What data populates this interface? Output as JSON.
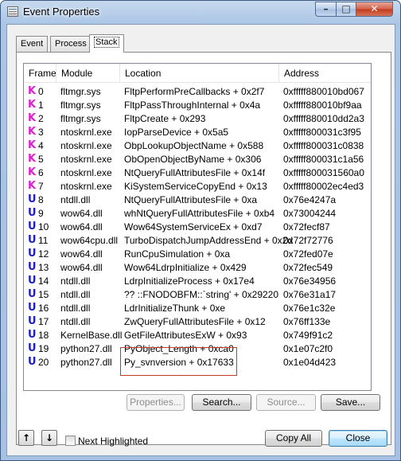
{
  "window": {
    "title": "Event Properties"
  },
  "caption_buttons": {
    "minimize": "–",
    "maximize": "□",
    "close": "✕"
  },
  "tabs": [
    {
      "label": "Event"
    },
    {
      "label": "Process"
    },
    {
      "label": "Stack"
    }
  ],
  "table": {
    "headers": {
      "frame": "Frame",
      "module": "Module",
      "location": "Location",
      "address": "Address"
    },
    "rows": [
      {
        "kind": "K",
        "frame": "0",
        "module": "fltmgr.sys",
        "location": "FltpPerformPreCallbacks + 0x2f7",
        "address": "0xfffff880010bd067"
      },
      {
        "kind": "K",
        "frame": "1",
        "module": "fltmgr.sys",
        "location": "FltpPassThroughInternal + 0x4a",
        "address": "0xfffff880010bf9aa"
      },
      {
        "kind": "K",
        "frame": "2",
        "module": "fltmgr.sys",
        "location": "FltpCreate + 0x293",
        "address": "0xfffff880010dd2a3"
      },
      {
        "kind": "K",
        "frame": "3",
        "module": "ntoskrnl.exe",
        "location": "IopParseDevice + 0x5a5",
        "address": "0xfffff800031c3f95"
      },
      {
        "kind": "K",
        "frame": "4",
        "module": "ntoskrnl.exe",
        "location": "ObpLookupObjectName + 0x588",
        "address": "0xfffff800031c0838"
      },
      {
        "kind": "K",
        "frame": "5",
        "module": "ntoskrnl.exe",
        "location": "ObOpenObjectByName + 0x306",
        "address": "0xfffff800031c1a56"
      },
      {
        "kind": "K",
        "frame": "6",
        "module": "ntoskrnl.exe",
        "location": "NtQueryFullAttributesFile + 0x14f",
        "address": "0xfffff800031560a0"
      },
      {
        "kind": "K",
        "frame": "7",
        "module": "ntoskrnl.exe",
        "location": "KiSystemServiceCopyEnd + 0x13",
        "address": "0xfffff80002ec4ed3"
      },
      {
        "kind": "U",
        "frame": "8",
        "module": "ntdll.dll",
        "location": "NtQueryFullAttributesFile + 0xa",
        "address": "0x76e4247a"
      },
      {
        "kind": "U",
        "frame": "9",
        "module": "wow64.dll",
        "location": "whNtQueryFullAttributesFile + 0xb4",
        "address": "0x73004244"
      },
      {
        "kind": "U",
        "frame": "10",
        "module": "wow64.dll",
        "location": "Wow64SystemServiceEx + 0xd7",
        "address": "0x72fecf87"
      },
      {
        "kind": "U",
        "frame": "11",
        "module": "wow64cpu.dll",
        "location": "TurboDispatchJumpAddressEnd + 0x2d",
        "address": "0x72f72776"
      },
      {
        "kind": "U",
        "frame": "12",
        "module": "wow64.dll",
        "location": "RunCpuSimulation + 0xa",
        "address": "0x72fed07e"
      },
      {
        "kind": "U",
        "frame": "13",
        "module": "wow64.dll",
        "location": "Wow64LdrpInitialize + 0x429",
        "address": "0x72fec549"
      },
      {
        "kind": "U",
        "frame": "14",
        "module": "ntdll.dll",
        "location": "LdrpInitializeProcess + 0x17e4",
        "address": "0x76e34956"
      },
      {
        "kind": "U",
        "frame": "15",
        "module": "ntdll.dll",
        "location": " ?? ::FNODOBFM::`string' + 0x29220",
        "address": "0x76e31a17"
      },
      {
        "kind": "U",
        "frame": "16",
        "module": "ntdll.dll",
        "location": "LdrInitializeThunk + 0xe",
        "address": "0x76e1c32e"
      },
      {
        "kind": "U",
        "frame": "17",
        "module": "ntdll.dll",
        "location": "ZwQueryFullAttributesFile + 0x12",
        "address": "0x76ff133e"
      },
      {
        "kind": "U",
        "frame": "18",
        "module": "KernelBase.dll",
        "location": "GetFileAttributesExW + 0x93",
        "address": "0x749f91c2"
      },
      {
        "kind": "U",
        "frame": "19",
        "module": "python27.dll",
        "location": "PyObject_Length + 0xca0",
        "address": "0x1e07c2f0"
      },
      {
        "kind": "U",
        "frame": "20",
        "module": "python27.dll",
        "location": "Py_svnversion + 0x17633",
        "address": "0x1e04d423"
      }
    ]
  },
  "buttons": {
    "properties": "Properties...",
    "search": "Search...",
    "source": "Source...",
    "save": "Save...",
    "copy_all": "Copy All",
    "close": "Close"
  },
  "nav": {
    "up": "↑",
    "down": "↓"
  },
  "next_highlighted": {
    "label": "Next Highlighted",
    "checked": false
  },
  "colors": {
    "kernel_frame": "#e020d0",
    "user_frame": "#1b1bd0",
    "highlight_box": "#c0392b"
  }
}
